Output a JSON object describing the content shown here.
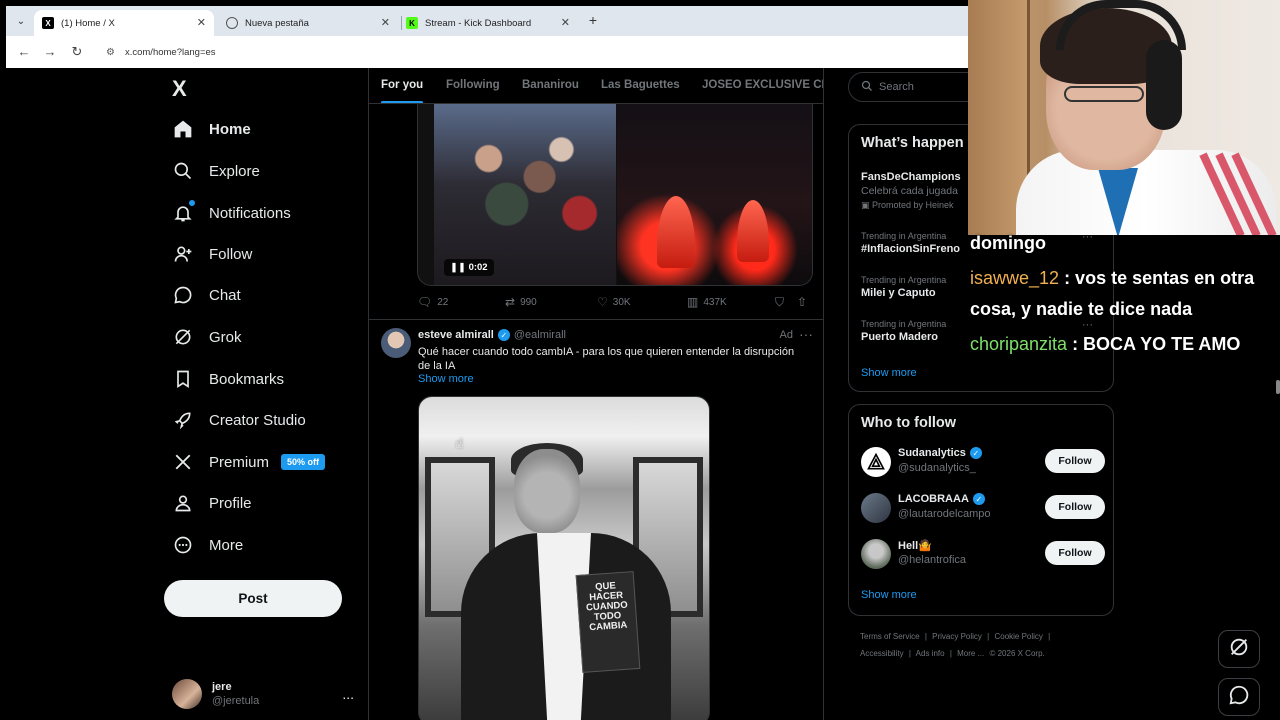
{
  "browser": {
    "tabs": [
      {
        "title": "(1) Home / X",
        "active": true
      },
      {
        "title": "Nueva pestaña",
        "active": false
      },
      {
        "title": "Stream - Kick Dashboard",
        "active": false
      }
    ],
    "url": "x.com/home?lang=es",
    "newtab_symbol": "+"
  },
  "nav": {
    "logo": "X",
    "items": [
      {
        "label": "Home",
        "icon": "home-icon"
      },
      {
        "label": "Explore",
        "icon": "search-icon"
      },
      {
        "label": "Notifications",
        "icon": "bell-icon"
      },
      {
        "label": "Follow",
        "icon": "add-person-icon"
      },
      {
        "label": "Chat",
        "icon": "chat-bubble-icon"
      },
      {
        "label": "Grok",
        "icon": "grok-icon"
      },
      {
        "label": "Bookmarks",
        "icon": "bookmark-icon"
      },
      {
        "label": "Creator Studio",
        "icon": "rocket-icon"
      },
      {
        "label": "Premium",
        "icon": "x-icon"
      },
      {
        "label": "Profile",
        "icon": "person-icon"
      },
      {
        "label": "More",
        "icon": "more-circle-icon"
      }
    ],
    "premium_badge": "50% off",
    "post_button": "Post",
    "account": {
      "name": "jere",
      "handle": "@jeretula",
      "more": "..."
    }
  },
  "feed": {
    "tabs": [
      "For you",
      "Following",
      "Bananirou",
      "Las Baguettes",
      "JOSEO EXCLUSIVE CLU"
    ],
    "video_time": "0:02",
    "actions": {
      "replies": "22",
      "reposts": "990",
      "likes": "30K",
      "views": "437K"
    },
    "ad_post": {
      "name": "esteve almirall",
      "handle": "@ealmirall",
      "ad_label": "Ad",
      "text": "Qué hacer cuando todo cambIA - para los que quieren  entender la disrupción de la IA",
      "show_more": "Show more",
      "book_title": "QUE HACER CUANDO TODO CAMBIA"
    }
  },
  "sidebar": {
    "search_placeholder": "Search",
    "trends_title": "What’s happen",
    "trends": [
      {
        "meta": "",
        "name": "FansDeChampions",
        "desc": "Celebrá cada jugada",
        "promo": "Promoted by Heinek"
      },
      {
        "meta": "Trending in Argentina",
        "name": "#InflacionSinFreno",
        "desc": "",
        "promo": ""
      },
      {
        "meta": "Trending in Argentina",
        "name": "Milei y Caputo",
        "desc": "",
        "promo": ""
      },
      {
        "meta": "Trending in Argentina",
        "name": "Puerto Madero",
        "desc": "",
        "promo": ""
      }
    ],
    "trends_show_more": "Show more",
    "who_to_follow_title": "Who to follow",
    "who_to_follow": [
      {
        "name": "Sudanalytics",
        "handle": "@sudanalytics_",
        "verified": true,
        "button": "Follow"
      },
      {
        "name": "LACOBRAAA",
        "handle": "@lautarodelcampo",
        "verified": true,
        "button": "Follow"
      },
      {
        "name": "Hell🤷",
        "handle": "@helantrofica",
        "verified": false,
        "button": "Follow"
      }
    ],
    "wtf_show_more": "Show more",
    "footer": [
      "Terms of Service",
      "|",
      "Privacy Policy",
      "|",
      "Cookie Policy",
      "|",
      "Accessibility",
      "|",
      "Ads info",
      "|",
      "More ...",
      "© 2026 X Corp."
    ]
  },
  "chat": {
    "messages": [
      {
        "user": "",
        "text": "domingo",
        "color": "#ffffff"
      },
      {
        "user": "isawwe_12",
        "text": " : vos te sentas en otra cosa, y nadie te dice nada",
        "color": "#f0b050"
      },
      {
        "user": "choripanzita",
        "text": " : BOCA YO TE AMO",
        "color": "#7ee06a"
      }
    ]
  },
  "colors": {
    "accent": "#1d9bf0",
    "background": "#000000",
    "border": "#2f3336",
    "muted": "#71767b"
  }
}
